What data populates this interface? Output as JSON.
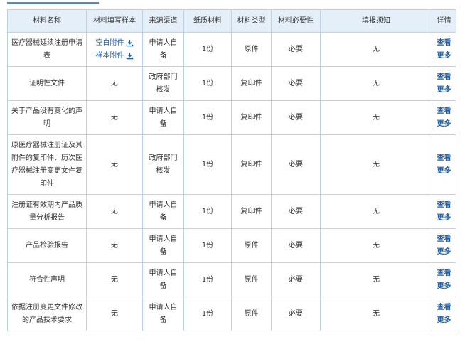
{
  "headers": {
    "name": "材料名称",
    "sample": "材料填写样本",
    "source": "来源渠道",
    "paper": "纸质材料",
    "type": "材料类型",
    "required": "材料必要性",
    "notes": "填报须知",
    "detail": "详情"
  },
  "detail_label": [
    "查看",
    "更多"
  ],
  "rows": [
    {
      "name": "医疗器械延续注册申请表",
      "sample": [
        "空白附件",
        "样本附件"
      ],
      "source": "申请人自备",
      "paper": "1份",
      "type": "原件",
      "required": "必要",
      "notes": "无"
    },
    {
      "name": "证明性文件",
      "sample": "无",
      "source": "政府部门核发",
      "paper": "1份",
      "type": "复印件",
      "required": "必要",
      "notes": "无"
    },
    {
      "name": "关于产品没有变化的声明",
      "sample": "无",
      "source": "申请人自备",
      "paper": "1份",
      "type": "复印件",
      "required": "必要",
      "notes": "无"
    },
    {
      "name": "原医疗器械注册证及其附件的复印件、历次医疗器械注册变更文件复印件",
      "sample": "无",
      "source": "政府部门核发",
      "paper": "1份",
      "type": "复印件",
      "required": "必要",
      "notes": "无"
    },
    {
      "name": "注册证有效期内产品质量分析报告",
      "sample": "无",
      "source": "申请人自备",
      "paper": "1份",
      "type": "复印件",
      "required": "必要",
      "notes": "无"
    },
    {
      "name": "产品检验报告",
      "sample": "无",
      "source": "申请人自备",
      "paper": "1份",
      "type": "原件",
      "required": "必要",
      "notes": "无"
    },
    {
      "name": "符合性声明",
      "sample": "无",
      "source": "申请人自备",
      "paper": "1份",
      "type": "原件",
      "required": "必要",
      "notes": "无"
    },
    {
      "name": "依据注册变更文件修改的产品技术要求",
      "sample": "无",
      "source": "申请人自备",
      "paper": "1份",
      "type": "原件",
      "required": "必要",
      "notes": "无"
    }
  ]
}
